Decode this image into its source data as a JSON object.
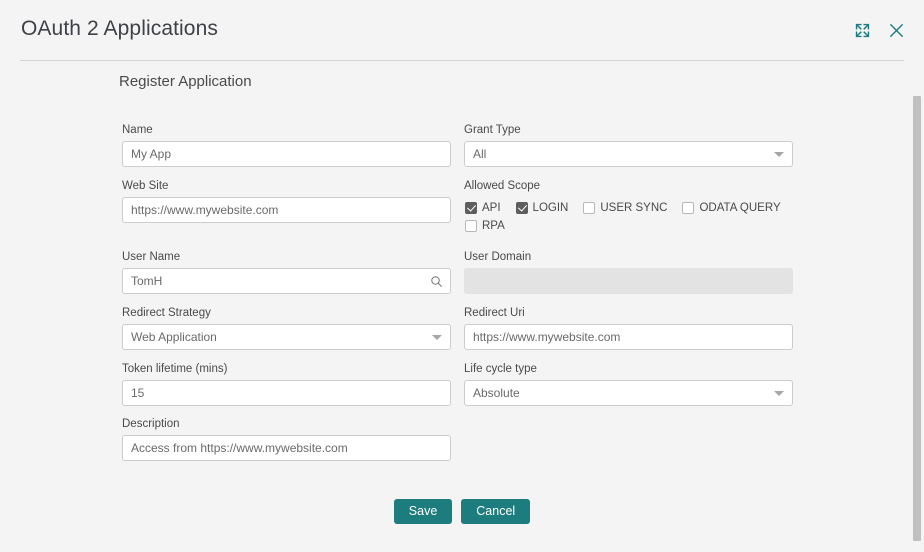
{
  "window": {
    "title": "OAuth 2 Applications",
    "actions": [
      {
        "name": "expand-icon",
        "label": "Expand"
      },
      {
        "name": "close-icon",
        "label": "Close"
      }
    ],
    "accent_color": "#1d7c7d"
  },
  "form": {
    "section_title": "Register Application",
    "fields": {
      "name": {
        "label": "Name",
        "value": "My App"
      },
      "web_site": {
        "label": "Web Site",
        "value": "https://www.mywebsite.com"
      },
      "user_name": {
        "label": "User Name",
        "value": "TomH",
        "icon": "search-icon"
      },
      "redirect_strategy": {
        "label": "Redirect Strategy",
        "value": "Web Application"
      },
      "token_lifetime": {
        "label": "Token lifetime (mins)",
        "value": "15"
      },
      "description": {
        "label": "Description",
        "value": "Access from https://www.mywebsite.com"
      },
      "grant_type": {
        "label": "Grant Type",
        "value": "All"
      },
      "allowed_scope": {
        "label": "Allowed Scope"
      },
      "user_domain": {
        "label": "User Domain",
        "value": ""
      },
      "redirect_uri": {
        "label": "Redirect Uri",
        "value": "https://www.mywebsite.com"
      },
      "life_cycle_type": {
        "label": "Life cycle type",
        "value": "Absolute"
      }
    },
    "scopes": [
      {
        "label": "API",
        "checked": true
      },
      {
        "label": "LOGIN",
        "checked": true
      },
      {
        "label": "USER SYNC",
        "checked": false
      },
      {
        "label": "ODATA QUERY",
        "checked": false
      },
      {
        "label": "RPA",
        "checked": false
      }
    ],
    "buttons": {
      "save": "Save",
      "cancel": "Cancel"
    }
  }
}
